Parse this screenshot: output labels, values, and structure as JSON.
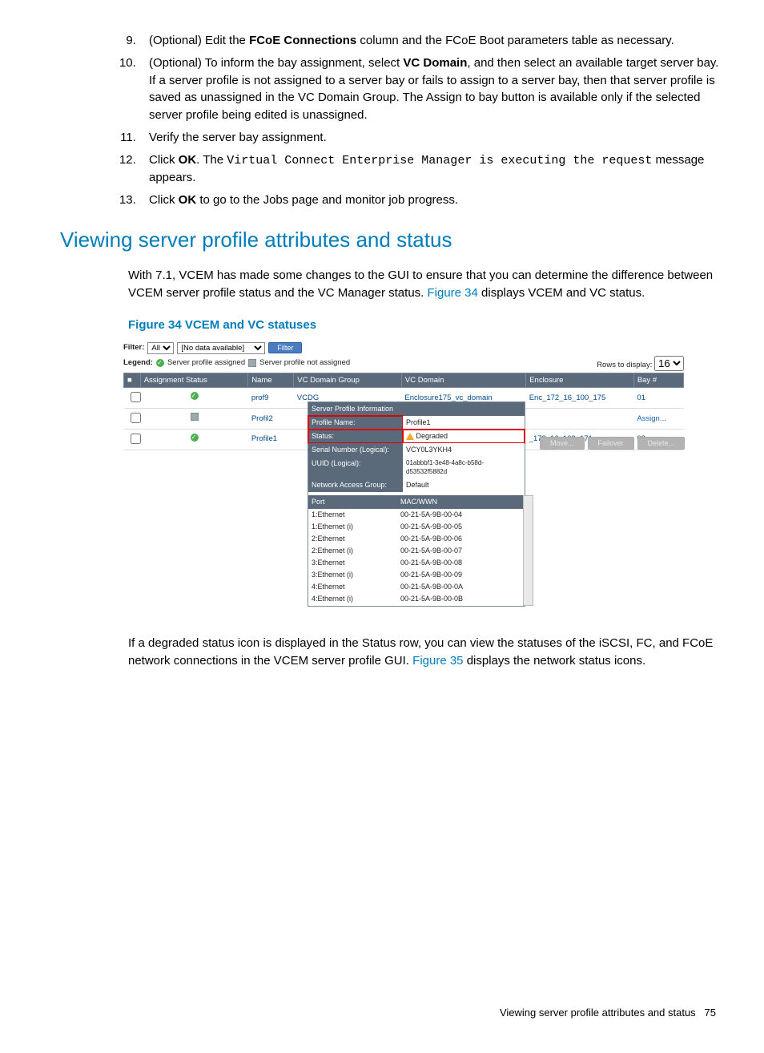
{
  "list": {
    "i9": "(Optional) Edit the ",
    "i9b": "FCoE Connections",
    "i9c": " column and the FCoE Boot parameters table as necessary.",
    "i10": "(Optional) To inform the bay assignment, select ",
    "i10b": "VC Domain",
    "i10c": ", and then select an available target server bay. If a server profile is not assigned to a server bay or fails to assign to a server bay, then that server profile is saved as unassigned in the VC Domain Group. The Assign to bay button is available only if the selected server profile being edited is unassigned.",
    "i11": "Verify the server bay assignment.",
    "i12a": "Click ",
    "i12b": "OK",
    "i12c": ". The ",
    "i12d": "Virtual Connect Enterprise Manager is executing the request",
    "i12e": " message appears.",
    "i13a": "Click ",
    "i13b": "OK",
    "i13c": " to go to the Jobs page and monitor job progress."
  },
  "section_heading": "Viewing server profile attributes and status",
  "para1a": "With 7.1, VCEM has made some changes to the GUI to ensure that you can determine the difference between VCEM server profile status and the VC Manager status. ",
  "para1link": "Figure 34",
  "para1b": " displays VCEM and VC status.",
  "fig_caption": "Figure 34 VCEM and VC statuses",
  "para2a": "If a degraded status icon is displayed in the Status row, you can view the statuses of the iSCSI, FC, and FCoE network connections in the VCEM server profile GUI. ",
  "para2link": "Figure 35",
  "para2b": " displays the network status icons.",
  "footer_text": "Viewing server profile attributes and status",
  "footer_page": "75",
  "shot": {
    "filter_label": "Filter:",
    "filter_all": "All",
    "nodata": "[No data available]",
    "filter_btn": "Filter",
    "legend": "Legend:",
    "legend_assigned": "Server profile assigned",
    "legend_not": "Server profile not assigned",
    "rows_display": "Rows to display:",
    "rows_value": "16",
    "headers": {
      "chk": " ",
      "assign": "Assignment Status",
      "name": "Name",
      "grp": "VC Domain Group",
      "dom": "VC Domain",
      "enc": "Enclosure",
      "bay": "Bay #"
    },
    "rows": [
      {
        "status": "ok",
        "name": "prof9",
        "grp": "VCDG",
        "dom": "Enclosure175_vc_domain",
        "enc": "Enc_172_16_100_175",
        "bay": "01"
      },
      {
        "status": "na",
        "name": "Profil2",
        "grp": "",
        "dom": "",
        "enc": "",
        "bay": "Assign..."
      },
      {
        "status": "ok",
        "name": "Profile1",
        "grp": "",
        "dom": "",
        "enc": "_172_16_102_171",
        "bay": "08"
      }
    ],
    "pop": {
      "title": "Server Profile Information",
      "name_l": "Profile Name:",
      "name_v": "Profile1",
      "status_l": "Status:",
      "status_v": "Degraded",
      "serial_l": "Serial Number (Logical):",
      "serial_v": "VCY0L3YKH4",
      "uuid_l": "UUID (Logical):",
      "uuid_v": "01abbbf1-3e48-4a8c-b58d-d53532f5882d",
      "nag_l": "Network Access Group:",
      "nag_v": "Default",
      "port_h": "Port",
      "mac_h": "MAC/WWN",
      "ports": [
        {
          "p": "1:Ethernet",
          "m": "00-21-5A-9B-00-04"
        },
        {
          "p": "1:Ethernet (i)",
          "m": "00-21-5A-9B-00-05"
        },
        {
          "p": "2:Ethernet",
          "m": "00-21-5A-9B-00-06"
        },
        {
          "p": "2:Ethernet (i)",
          "m": "00-21-5A-9B-00-07"
        },
        {
          "p": "3:Ethernet",
          "m": "00-21-5A-9B-00-08"
        },
        {
          "p": "3:Ethernet (i)",
          "m": "00-21-5A-9B-00-09"
        },
        {
          "p": "4:Ethernet",
          "m": "00-21-5A-9B-00-0A"
        },
        {
          "p": "4:Ethernet (i)",
          "m": "00-21-5A-9B-00-0B"
        }
      ],
      "btn_move": "Move...",
      "btn_fail": "Failover",
      "btn_del": "Delete..."
    }
  }
}
